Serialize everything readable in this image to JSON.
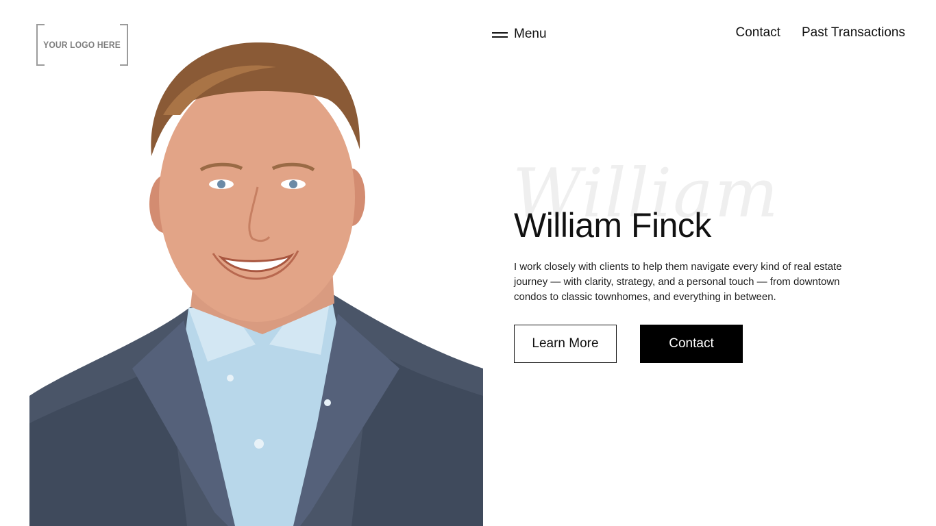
{
  "logo": {
    "text": "YOUR LOGO HERE"
  },
  "nav": {
    "menu_label": "Menu",
    "links": [
      {
        "label": "Contact"
      },
      {
        "label": "Past Transactions"
      }
    ]
  },
  "hero": {
    "script_name": "William",
    "name": "William Finck",
    "description": "I work closely with clients to help them navigate every kind of real estate journey — with clarity, strategy, and a personal touch — from downtown condos to classic townhomes, and everything in between.",
    "learn_more_label": "Learn More",
    "contact_label": "Contact"
  },
  "colors": {
    "text": "#111111",
    "button_solid_bg": "#000000",
    "button_solid_text": "#ffffff",
    "script_watermark": "#efefef",
    "logo_gray": "#7d7d7d"
  },
  "icons": {
    "menu": "hamburger-icon"
  }
}
